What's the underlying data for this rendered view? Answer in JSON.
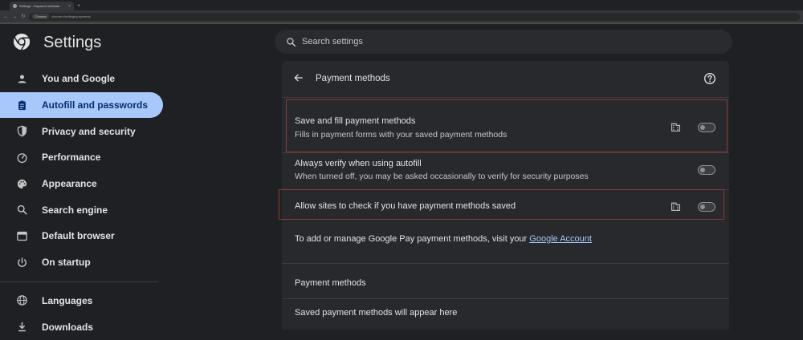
{
  "browser": {
    "tab_title": "Settings - Payment methods",
    "tab_close": "×",
    "new_tab": "+",
    "chip": "Chrome",
    "url": "chrome://settings/payments"
  },
  "header": {
    "title": "Settings",
    "search_placeholder": "Search settings"
  },
  "sidebar": {
    "items": [
      {
        "label": "You and Google",
        "icon": "person-icon"
      },
      {
        "label": "Autofill and passwords",
        "icon": "clipboard-icon",
        "active": true
      },
      {
        "label": "Privacy and security",
        "icon": "shield-icon"
      },
      {
        "label": "Performance",
        "icon": "speedometer-icon"
      },
      {
        "label": "Appearance",
        "icon": "palette-icon"
      },
      {
        "label": "Search engine",
        "icon": "search-icon"
      },
      {
        "label": "Default browser",
        "icon": "browser-icon"
      },
      {
        "label": "On startup",
        "icon": "power-icon"
      },
      {
        "label": "Languages",
        "icon": "globe-icon"
      },
      {
        "label": "Downloads",
        "icon": "download-icon"
      }
    ]
  },
  "page": {
    "title": "Payment methods",
    "settings": [
      {
        "primary": "Save and fill payment methods",
        "secondary": "Fills in payment forms with your saved payment methods",
        "managed": true,
        "enabled": false
      },
      {
        "primary": "Always verify when using autofill",
        "secondary": "When turned off, you may be asked occasionally to verify for security purposes",
        "managed": false,
        "enabled": false
      },
      {
        "primary": "Allow sites to check if you have payment methods saved",
        "managed": true,
        "enabled": false
      }
    ],
    "gpay_text": "To add or manage Google Pay payment methods, visit your ",
    "gpay_link": "Google Account",
    "section_title": "Payment methods",
    "empty_message": "Saved payment methods will appear here"
  },
  "colors": {
    "background": "#1f2023",
    "card": "#28292c",
    "active_nav": "#a8c7fa",
    "link": "#a8c7fa",
    "highlight_border": "#8a3a3a"
  }
}
